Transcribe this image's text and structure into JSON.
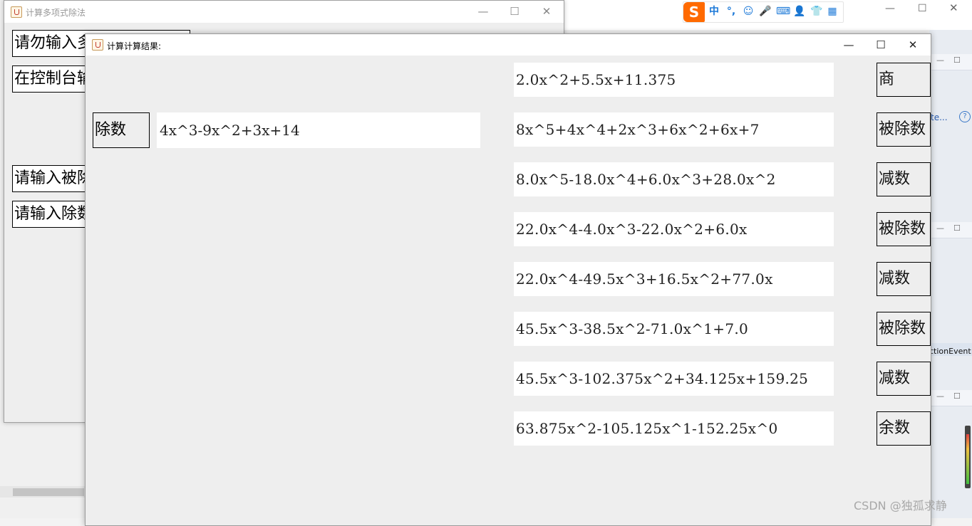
{
  "ime": {
    "logo": "S",
    "items": [
      "中",
      "°,",
      "☺",
      "🎤",
      "⌨",
      "👤",
      "👕",
      "▦"
    ]
  },
  "ide": {
    "side_text_1": "te...",
    "side_text_2": "ctionEvent"
  },
  "watermark": "CSDN @独孤求静",
  "back_window": {
    "title": "计算多项式除法",
    "fields": [
      "请勿输入多",
      "在控制台输",
      "请输入被除",
      "请输入除数"
    ]
  },
  "result_window": {
    "title": "计算计算结果:",
    "divisor_label": "除数",
    "divisor_value": "4x^3-9x^2+3x+14",
    "rows": [
      {
        "value": "2.0x^2+5.5x+11.375",
        "tag": "商"
      },
      {
        "value": "8x^5+4x^4+2x^3+6x^2+6x+7",
        "tag": "被除数"
      },
      {
        "value": "8.0x^5-18.0x^4+6.0x^3+28.0x^2",
        "tag": "减数"
      },
      {
        "value": "22.0x^4-4.0x^3-22.0x^2+6.0x",
        "tag": "被除数"
      },
      {
        "value": "22.0x^4-49.5x^3+16.5x^2+77.0x",
        "tag": "减数"
      },
      {
        "value": "45.5x^3-38.5x^2-71.0x^1+7.0",
        "tag": "被除数"
      },
      {
        "value": "45.5x^3-102.375x^2+34.125x+159.25",
        "tag": "减数"
      },
      {
        "value": "63.875x^2-105.125x^1-152.25x^0",
        "tag": "余数"
      }
    ]
  },
  "window_controls": {
    "minimize": "—",
    "maximize": "☐",
    "close": "✕"
  }
}
